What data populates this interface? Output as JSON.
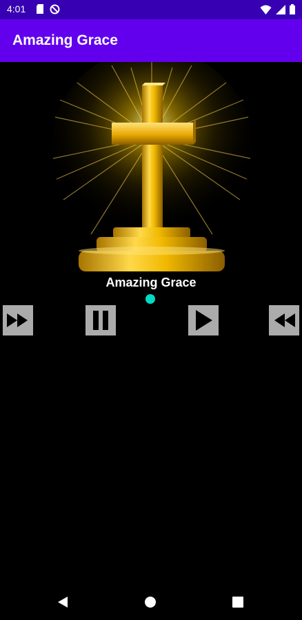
{
  "status_bar": {
    "time": "4:01",
    "left_icons": [
      "sd-card-icon",
      "do-not-disturb-icon"
    ],
    "right_icons": [
      "wifi-icon",
      "signal-icon",
      "battery-icon"
    ]
  },
  "app_bar": {
    "title": "Amazing Grace"
  },
  "player": {
    "song_title": "Amazing Grace",
    "controls": [
      {
        "name": "fast-forward-button",
        "icon": "fast-forward-icon"
      },
      {
        "name": "pause-button",
        "icon": "pause-icon"
      },
      {
        "name": "play-button",
        "icon": "play-icon"
      },
      {
        "name": "rewind-button",
        "icon": "rewind-icon"
      }
    ]
  },
  "nav_bar": {
    "buttons": [
      "back-icon",
      "home-icon",
      "recents-icon"
    ]
  },
  "colors": {
    "status_bar": "#3700b3",
    "app_bar": "#6200ee",
    "background": "#000000",
    "accent": "#03dac5",
    "button": "#ababab"
  }
}
